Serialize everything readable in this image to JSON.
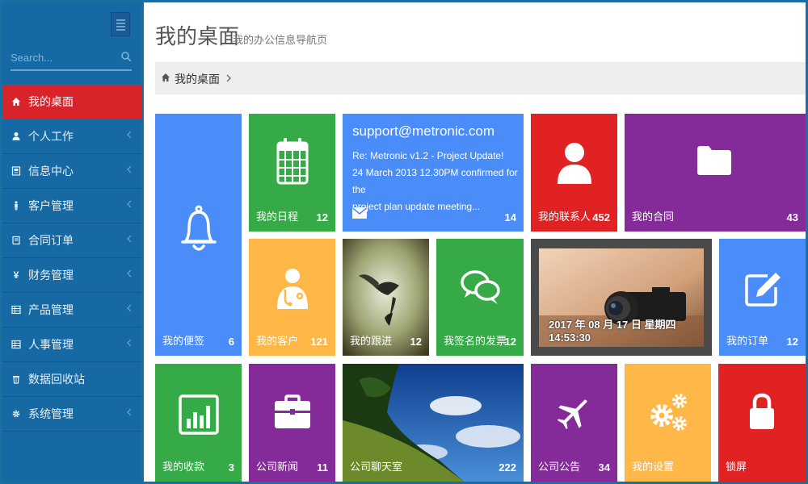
{
  "sidebar": {
    "search": {
      "placeholder": "Search...",
      "value": ""
    },
    "items": [
      {
        "label": "我的桌面",
        "icon": "home-icon",
        "active": true
      },
      {
        "label": "个人工作",
        "icon": "user-icon"
      },
      {
        "label": "信息中心",
        "icon": "news-icon"
      },
      {
        "label": "客户管理",
        "icon": "person-icon"
      },
      {
        "label": "合同订单",
        "icon": "book-icon"
      },
      {
        "label": "财务管理",
        "icon": "yen-icon"
      },
      {
        "label": "产品管理",
        "icon": "table-icon"
      },
      {
        "label": "人事管理",
        "icon": "table-icon"
      },
      {
        "label": "数据回收站",
        "icon": "trash-icon"
      },
      {
        "label": "系统管理",
        "icon": "gear-icon"
      }
    ]
  },
  "header": {
    "title": "我的桌面",
    "subtitle": "我的办公信息导航页"
  },
  "breadcrumb": {
    "home": "我的桌面"
  },
  "tiles": {
    "notes": {
      "label": "我的便签",
      "count": "6"
    },
    "calendar": {
      "label": "我的日程",
      "count": "12"
    },
    "mail": {
      "address": "support@metronic.com",
      "line1": "Re: Metronic v1.2 - Project Update!",
      "line2": "24 March 2013 12.30PM confirmed for the",
      "line3": "project plan update meeting...",
      "count": "14"
    },
    "contacts": {
      "label": "我的联系人",
      "count": "452"
    },
    "contracts": {
      "label": "我的合同",
      "count": "43"
    },
    "customers": {
      "label": "我的客户",
      "count": "121"
    },
    "followup": {
      "label": "我的跟进",
      "count": "12"
    },
    "invoices": {
      "label": "我签名的发票",
      "count": "12"
    },
    "clock": {
      "text": "2017 年 08 月 17 日 星期四 14:53:30"
    },
    "orders": {
      "label": "我的订单",
      "count": "12"
    },
    "receipts": {
      "label": "我的收款",
      "count": "3"
    },
    "news": {
      "label": "公司新闻",
      "count": "11"
    },
    "chat": {
      "label": "公司聊天室",
      "count": "222"
    },
    "notice": {
      "label": "公司公告",
      "count": "34"
    },
    "settings": {
      "label": "我的设置",
      "count": ""
    },
    "lock": {
      "label": "锁屏",
      "count": ""
    }
  }
}
